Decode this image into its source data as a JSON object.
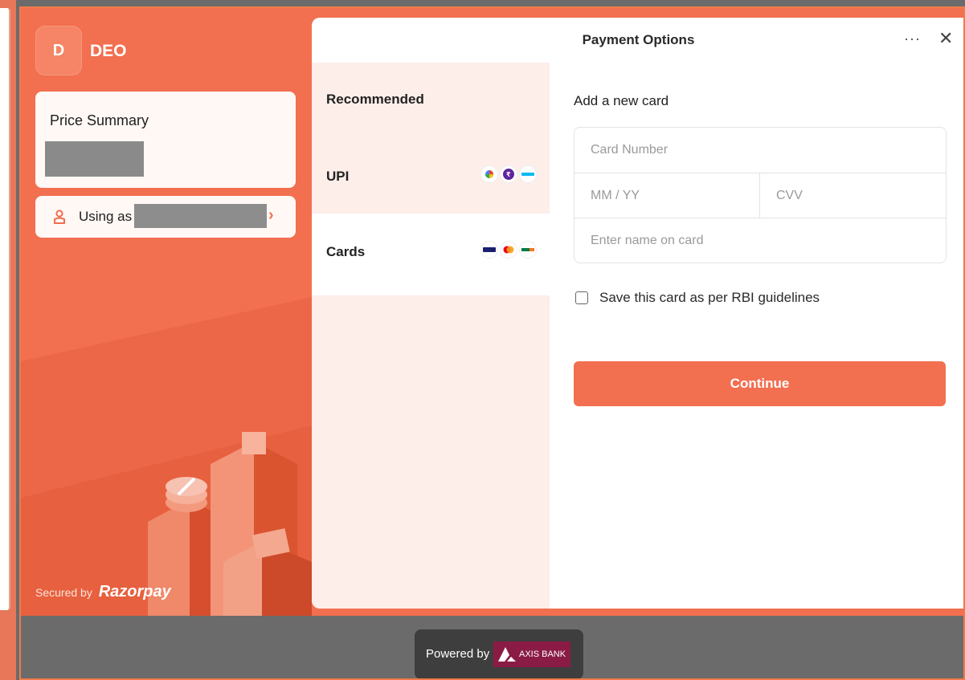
{
  "merchant": {
    "initial": "D",
    "name": "DEO"
  },
  "price_summary": {
    "title": "Price Summary"
  },
  "using_as": {
    "label": "Using as",
    "chevron": "›"
  },
  "footer_left": {
    "secured_by": "Secured by",
    "brand": "Razorpay"
  },
  "modal": {
    "title": "Payment Options",
    "more_icon": "···",
    "close_icon": "✕"
  },
  "methods": {
    "heading": "Recommended",
    "items": [
      {
        "label": "UPI",
        "logos": [
          "google-pay-icon",
          "phonepe-icon",
          "paytm-icon"
        ]
      },
      {
        "label": "Cards",
        "logos": [
          "visa-icon",
          "mastercard-icon",
          "rupay-icon"
        ]
      }
    ]
  },
  "card_form": {
    "title": "Add a new card",
    "card_number_placeholder": "Card Number",
    "expiry_placeholder": "MM / YY",
    "cvv_placeholder": "CVV",
    "name_placeholder": "Enter name on card",
    "save_label": "Save this card as per RBI guidelines",
    "save_checked": false,
    "continue_label": "Continue"
  },
  "powered_by": {
    "label": "Powered by",
    "bank": "AXIS BANK"
  },
  "colors": {
    "brand": "#f26f50",
    "panel": "#fdeeea",
    "axis": "#8a1b45"
  }
}
